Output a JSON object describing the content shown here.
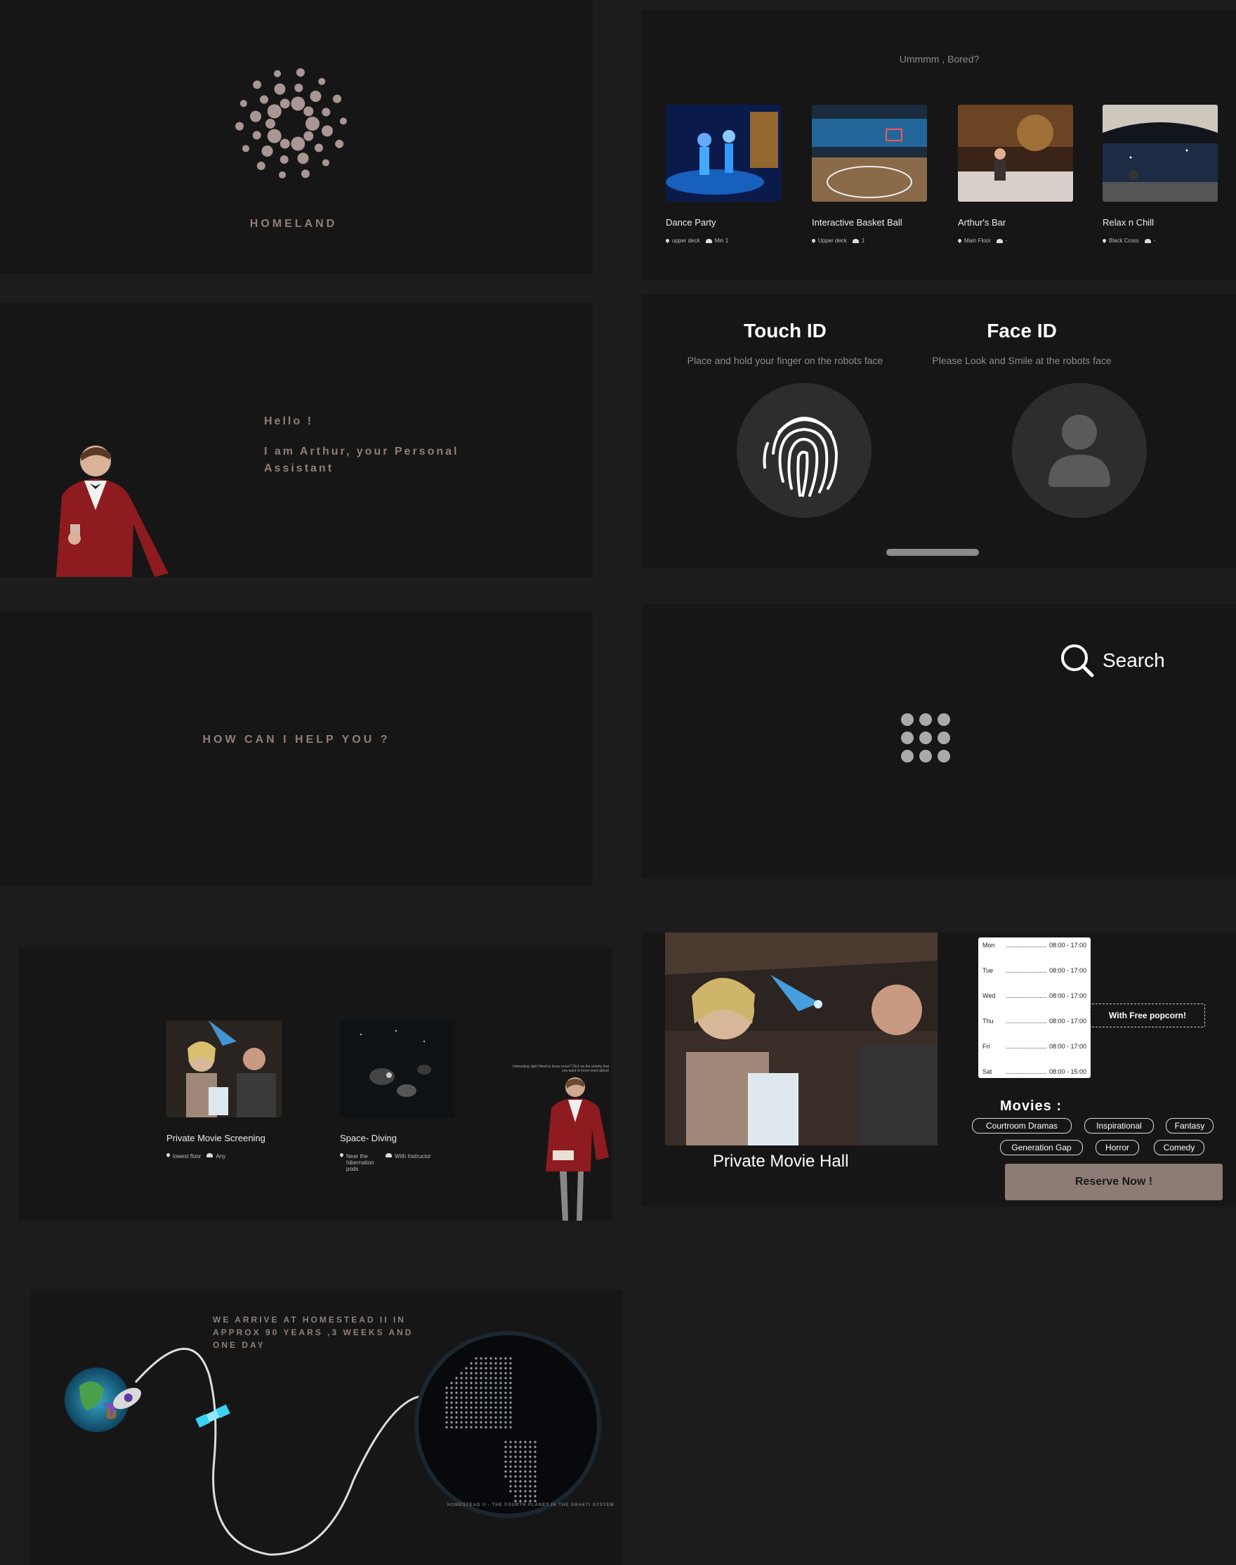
{
  "logo": {
    "brand": "HOMELAND"
  },
  "activities": {
    "title": "Ummmm , Bored?",
    "items": [
      {
        "name": "Dance Party",
        "location": "upper deck",
        "people": "Min 1"
      },
      {
        "name": "Interactive Basket Ball",
        "location": "Upper deck",
        "people": "1"
      },
      {
        "name": "Arthur's Bar",
        "location": "Main Floor",
        "people": "-"
      },
      {
        "name": "Relax n Chill",
        "location": "Black Cross",
        "people": "-"
      }
    ]
  },
  "hello": {
    "greeting": "Hello !",
    "intro": "I am Arthur, your Personal Assistant"
  },
  "auth": {
    "touch": {
      "title": "Touch ID",
      "subtitle": "Place and hold your finger on the robots face"
    },
    "face": {
      "title": "Face ID",
      "subtitle": "Please Look and Smile at the robots face"
    }
  },
  "help": {
    "question": "HOW CAN I HELP YOU ?"
  },
  "search": {
    "label": "Search"
  },
  "movie_activities": {
    "items": [
      {
        "name": "Private Movie Screening",
        "location": "lowest floor",
        "people": "Any"
      },
      {
        "name": "Space- Diving",
        "location": "Near the hibernation pods",
        "people": "With Instructor"
      }
    ],
    "assistant_note": "Interesting right! Want to know more? Click on the activity that you want to know more about!"
  },
  "hall": {
    "title": "Private Movie Hall",
    "schedule": [
      {
        "day": "Mon",
        "hours": "08:00 - 17:00"
      },
      {
        "day": "Tue",
        "hours": "08:00 - 17:00"
      },
      {
        "day": "Wed",
        "hours": "08:00 - 17:00"
      },
      {
        "day": "Thu",
        "hours": "08:00 - 17:00"
      },
      {
        "day": "Fri",
        "hours": "08:00 - 17:00"
      },
      {
        "day": "Sat",
        "hours": "08:00 - 15:00"
      }
    ],
    "popcorn": "With Free popcorn!",
    "movies_heading": "Movies :",
    "genres": [
      "Courtroom Dramas",
      "Inspirational",
      "Fantasy",
      "Generation Gap",
      "Horror",
      "Comedy"
    ],
    "reserve": "Reserve Now !"
  },
  "journey": {
    "arrival": "WE ARRIVE AT HOMESTEAD II IN APPROX 90 YEARS ,3 WEEKS AND ONE DAY",
    "planet_note": "HOMESTEAD II - THE FOURTH PLANET IN THE SHAKTI SYSTEM"
  },
  "colors": {
    "panel": "#161616",
    "background": "#1c1c1d",
    "accent": "#8e7b75",
    "muted": "#8c8c8c"
  }
}
